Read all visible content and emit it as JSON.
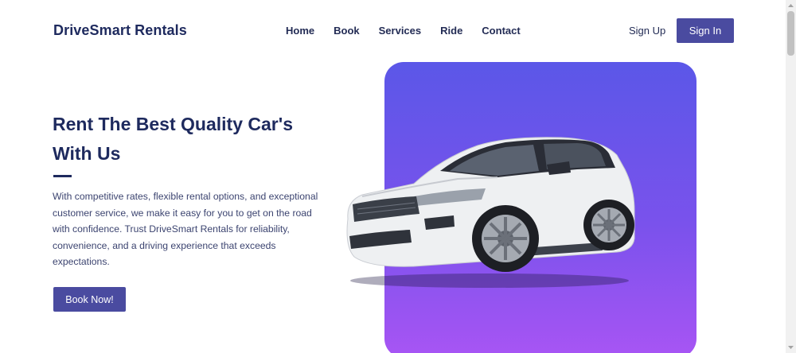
{
  "navbar": {
    "brand": "DriveSmart Rentals",
    "links": [
      "Home",
      "Book",
      "Services",
      "Ride",
      "Contact"
    ],
    "signup_label": "Sign Up",
    "signin_label": "Sign In"
  },
  "hero": {
    "title_line1": "Rent The Best Quality Car's",
    "title_line2": "With Us",
    "description": "With competitive rates, flexible rental options, and exceptional customer service, we make it easy for you to get on the road with confidence. Trust DriveSmart Rentals for reliability, convenience, and a driving experience that exceeds expectations.",
    "cta_label": "Book Now!"
  },
  "colors": {
    "primary": "#4a4ba0",
    "heading": "#1e2a5e",
    "gradient_top": "#5b57e8",
    "gradient_bottom": "#a855f4"
  },
  "icons": {
    "scroll_up": "triangle-up-icon",
    "scroll_down": "triangle-down-icon"
  }
}
